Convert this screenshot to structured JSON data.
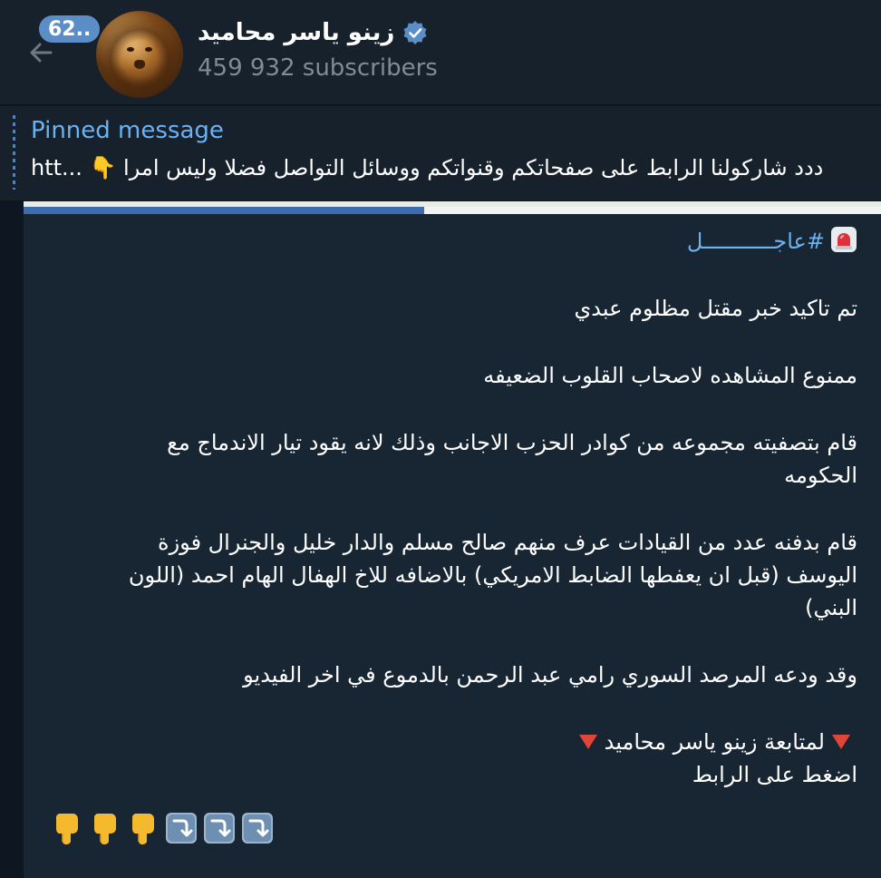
{
  "header": {
    "unread_badge": "62..",
    "channel_name": "زينو ياسر محاميد",
    "subscribers": "459 932 subscribers"
  },
  "pinned": {
    "title": "Pinned message",
    "text": "ددد  شاركولنا الرابط على صفحاتكم وقنواتكم ووسائل التواصل فضلا وليس امرا 👇 ...htt"
  },
  "message": {
    "header_hashtag": "#عاجـــــــــــل",
    "lines": [
      "تم تاكيد خبر مقتل مظلوم عبدي",
      "ممنوع المشاهده لاصحاب القلوب الضعيفه",
      "قام بتصفيته مجموعه من كوادر الحزب الاجانب وذلك لانه يقود تيار الاندماج مع الحكومه",
      "قام بدفنه عدد من القيادات عرف منهم صالح مسلم والدار خليل والجنرال فوزة اليوسف (قبل ان يعفطها الضابط الامريكي) بالاضافه للاخ الهفال الهام احمد (اللون البني)",
      "وقد ودعه المرصد السوري رامي عبد الرحمن بالدموع في اخر الفيديو"
    ],
    "follow_text": "لمتابعة زينو ياسر محاميد",
    "press_link": "اضغط على الرابط"
  },
  "colors": {
    "header_bg": "#17212b",
    "chat_bg": "#0e1621",
    "bubble_bg": "#182533",
    "accent": "#6ab2f2",
    "badge": "#5b8dc6",
    "muted": "#7f8b97"
  },
  "icons": {
    "back": "arrow-left-icon",
    "verified": "verified-check-icon",
    "siren": "siren-icon",
    "triangle": "red-triangle-down-icon",
    "point_down": "point-down-icon",
    "arrow_box": "arrow-turn-down-box-icon"
  }
}
